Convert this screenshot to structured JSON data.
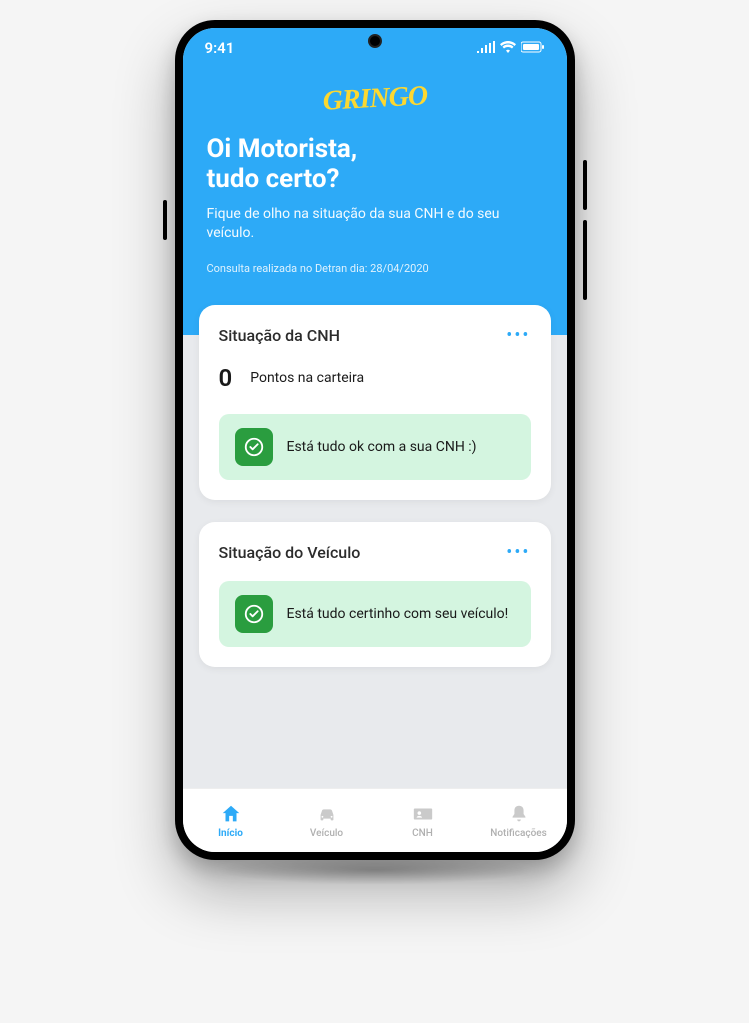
{
  "status_bar": {
    "time": "9:41"
  },
  "logo": "GRINGO",
  "header": {
    "greeting_line1": "Oi Motorista,",
    "greeting_line2": "tudo certo?",
    "subtitle": "Fique de olho na situação da sua CNH e do seu veículo.",
    "consult_note": "Consulta realizada no Detran dia: 28/04/2020"
  },
  "cnh_card": {
    "title": "Situação da CNH",
    "points_value": "0",
    "points_label": "Pontos na carteira",
    "status_message": "Está tudo ok com a sua CNH :)"
  },
  "vehicle_card": {
    "title": "Situação do Veículo",
    "status_message": "Está tudo certinho com seu veículo!"
  },
  "nav": {
    "items": [
      {
        "label": "Início"
      },
      {
        "label": "Veículo"
      },
      {
        "label": "CNH"
      },
      {
        "label": "Notificações"
      }
    ]
  }
}
